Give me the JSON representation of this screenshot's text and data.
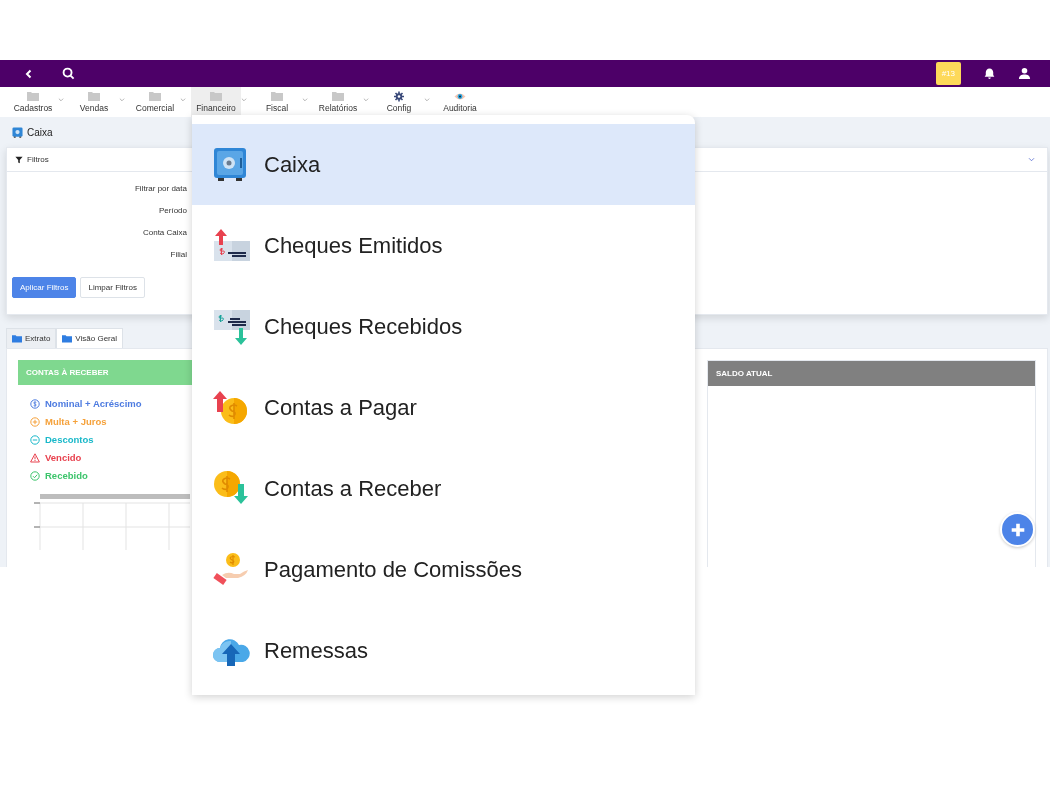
{
  "topbar": {
    "badge": "#13"
  },
  "menu": [
    {
      "label": "Cadastros",
      "kind": "folder",
      "has_caret": true,
      "selected": false
    },
    {
      "label": "Vendas",
      "kind": "folder",
      "has_caret": true,
      "selected": false
    },
    {
      "label": "Comercial",
      "kind": "folder",
      "has_caret": true,
      "selected": false
    },
    {
      "label": "Financeiro",
      "kind": "folder",
      "has_caret": true,
      "selected": true
    },
    {
      "label": "Fiscal",
      "kind": "folder",
      "has_caret": true,
      "selected": false
    },
    {
      "label": "Relatórios",
      "kind": "folder",
      "has_caret": true,
      "selected": false
    },
    {
      "label": "Config",
      "kind": "gear",
      "has_caret": true,
      "selected": false
    },
    {
      "label": "Auditoria",
      "kind": "eye",
      "has_caret": false,
      "selected": false
    }
  ],
  "page": {
    "title": "Caixa"
  },
  "filters": {
    "title": "Filtros",
    "labels": [
      "Filtrar por data",
      "Período",
      "Conta Caixa",
      "Filial"
    ],
    "buttons": [
      {
        "label": "Aplicar Filtros",
        "kind": "primary"
      },
      {
        "label": "Limpar Filtros",
        "kind": "secondary"
      }
    ]
  },
  "tabs": [
    {
      "label": "Extrato",
      "selected": false
    },
    {
      "label": "Visão Geral",
      "selected": true
    }
  ],
  "receivables_card": {
    "title": "CONTAS À RECEBER",
    "legend": [
      {
        "label": "Nominal + Acréscimo",
        "kind": "dollar",
        "color": "#4d7be0"
      },
      {
        "label": "Multa + Juros",
        "kind": "plus",
        "color": "#f5a13a"
      },
      {
        "label": "Descontos",
        "kind": "minus",
        "color": "#19b8c9"
      },
      {
        "label": "Vencido",
        "kind": "warning",
        "color": "#e8424f"
      },
      {
        "label": "Recebido",
        "kind": "check",
        "color": "#3cc46b"
      }
    ]
  },
  "balance_card": {
    "title": "SALDO ATUAL"
  },
  "dropdown": {
    "items": [
      {
        "label": "Caixa",
        "kind": "safe",
        "selected": true
      },
      {
        "label": "Cheques Emitidos",
        "kind": "check-out",
        "selected": false
      },
      {
        "label": "Cheques Recebidos",
        "kind": "check-in",
        "selected": false
      },
      {
        "label": "Contas a Pagar",
        "kind": "coin-up",
        "selected": false
      },
      {
        "label": "Contas a Receber",
        "kind": "coin-down",
        "selected": false
      },
      {
        "label": "Pagamento de Comissões",
        "kind": "hand-coin",
        "selected": false
      },
      {
        "label": "Remessas",
        "kind": "cloud-upload",
        "selected": false
      }
    ]
  }
}
